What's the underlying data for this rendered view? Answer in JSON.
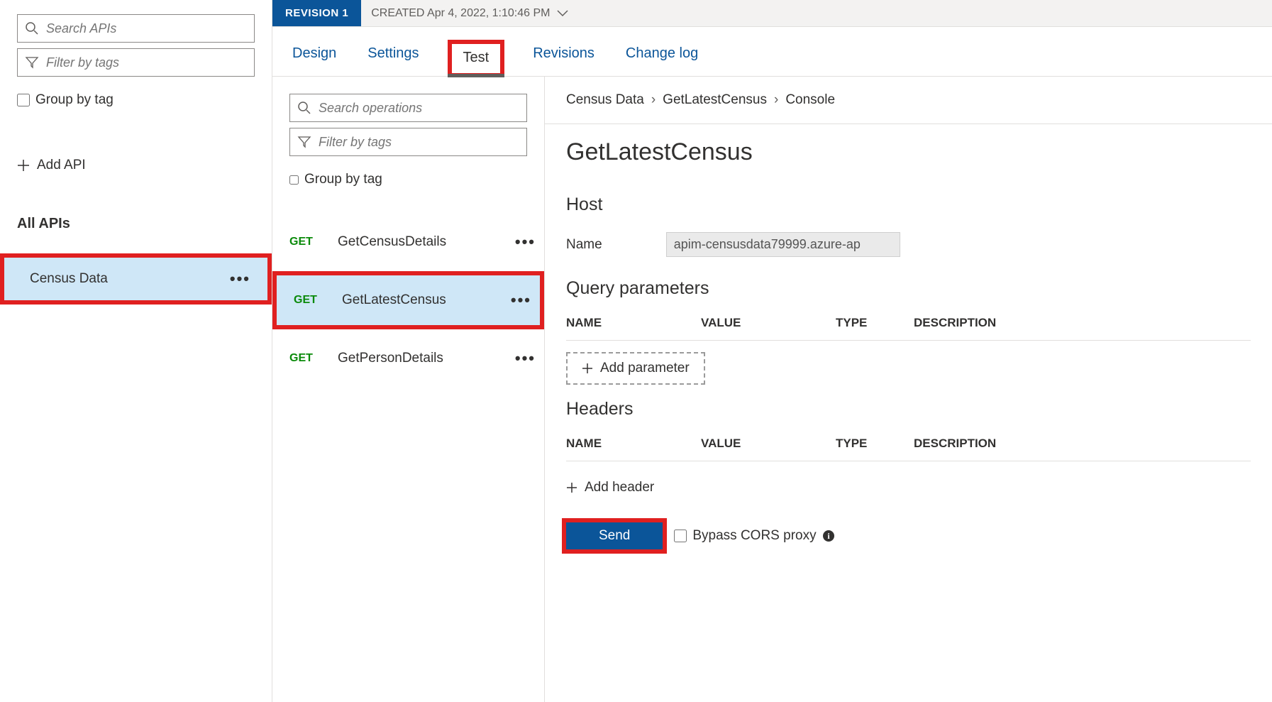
{
  "sidebar": {
    "search_placeholder": "Search APIs",
    "filter_placeholder": "Filter by tags",
    "group_by_tag_label": "Group by tag",
    "add_api_label": "Add API",
    "all_apis_label": "All APIs",
    "apis": [
      {
        "name": "Census Data",
        "selected": true,
        "highlighted": true
      }
    ]
  },
  "revision": {
    "badge": "REVISION 1",
    "created_label": "CREATED Apr 4, 2022, 1:10:46 PM"
  },
  "tabs": [
    {
      "label": "Design",
      "active": false,
      "highlighted": false
    },
    {
      "label": "Settings",
      "active": false,
      "highlighted": false
    },
    {
      "label": "Test",
      "active": true,
      "highlighted": true
    },
    {
      "label": "Revisions",
      "active": false,
      "highlighted": false
    },
    {
      "label": "Change log",
      "active": false,
      "highlighted": false
    }
  ],
  "operations_panel": {
    "search_placeholder": "Search operations",
    "filter_placeholder": "Filter by tags",
    "group_by_tag_label": "Group by tag",
    "operations": [
      {
        "method": "GET",
        "name": "GetCensusDetails",
        "selected": false,
        "highlighted": false
      },
      {
        "method": "GET",
        "name": "GetLatestCensus",
        "selected": true,
        "highlighted": true
      },
      {
        "method": "GET",
        "name": "GetPersonDetails",
        "selected": false,
        "highlighted": false
      }
    ]
  },
  "details": {
    "breadcrumb": [
      "Census Data",
      "GetLatestCensus",
      "Console"
    ],
    "title": "GetLatestCensus",
    "host_section_title": "Host",
    "host_name_label": "Name",
    "host_value": "apim-censusdata79999.azure-ap",
    "query_params_title": "Query parameters",
    "headers_title": "Headers",
    "columns": {
      "name": "NAME",
      "value": "VALUE",
      "type": "TYPE",
      "description": "DESCRIPTION"
    },
    "add_parameter_label": "Add parameter",
    "add_header_label": "Add header",
    "send_label": "Send",
    "bypass_label": "Bypass CORS proxy"
  }
}
